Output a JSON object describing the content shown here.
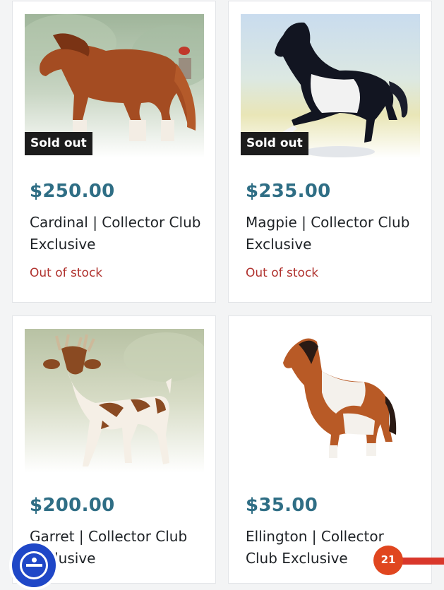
{
  "products": [
    {
      "price": "$250.00",
      "title": "Cardinal | Collector Club Exclusive",
      "badge": "Sold out",
      "stock": "Out of stock"
    },
    {
      "price": "$235.00",
      "title": "Magpie | Collector Club Exclusive",
      "badge": "Sold out",
      "stock": "Out of stock"
    },
    {
      "price": "$200.00",
      "title": "Garret | Collector Club Exclusive"
    },
    {
      "price": "$35.00",
      "title": "Ellington | Collector Club Exclusive"
    }
  ],
  "floating": {
    "accessibility_icon": "accessibility-icon",
    "notification_count": "21"
  },
  "colors": {
    "price": "#2f6e85",
    "out_of_stock": "#b0322e",
    "badge_bg": "#1c1c1c",
    "accessibility": "#1f47c7",
    "notification": "#e0461f"
  }
}
